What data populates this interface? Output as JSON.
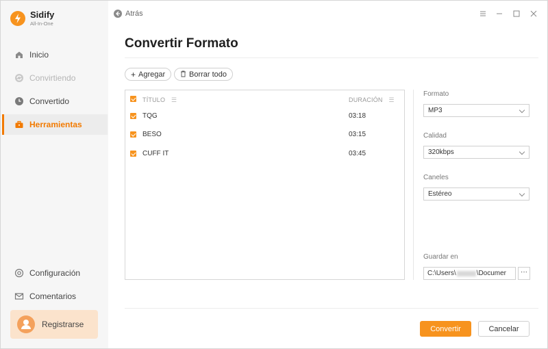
{
  "app": {
    "name": "Sidify",
    "subtitle": "All-In-One",
    "brand_color": "#f7931e"
  },
  "sidebar": {
    "items": [
      {
        "label": "Inicio",
        "icon": "home-icon",
        "state": "normal"
      },
      {
        "label": "Convirtiendo",
        "icon": "sync-icon",
        "state": "disabled"
      },
      {
        "label": "Convertido",
        "icon": "clock-icon",
        "state": "normal"
      },
      {
        "label": "Herramientas",
        "icon": "toolbox-icon",
        "state": "active"
      }
    ],
    "bottom_items": [
      {
        "label": "Configuración",
        "icon": "gear-icon"
      },
      {
        "label": "Comentarios",
        "icon": "mail-icon"
      }
    ],
    "register_label": "Registrarse"
  },
  "topbar": {
    "back_label": "Atrás"
  },
  "page": {
    "title": "Convertir Formato"
  },
  "toolbar": {
    "add_label": "Agregar",
    "clear_label": "Borrar todo"
  },
  "tracklist": {
    "columns": {
      "title": "TÍTULO",
      "duration": "DURACIÓN"
    },
    "rows": [
      {
        "title": "TQG",
        "duration": "03:18",
        "checked": true
      },
      {
        "title": "BESO",
        "duration": "03:15",
        "checked": true
      },
      {
        "title": "CUFF IT",
        "duration": "03:45",
        "checked": true
      }
    ]
  },
  "settings": {
    "format_label": "Formato",
    "format_value": "MP3",
    "quality_label": "Calidad",
    "quality_value": "320kbps",
    "channels_label": "Caneles",
    "channels_value": "Estéreo",
    "output_label": "Guardar en",
    "output_path_prefix": "C:\\Users\\",
    "output_path_suffix": "\\Documer",
    "browse_label": "···"
  },
  "actions": {
    "convert_label": "Convertir",
    "cancel_label": "Cancelar"
  }
}
